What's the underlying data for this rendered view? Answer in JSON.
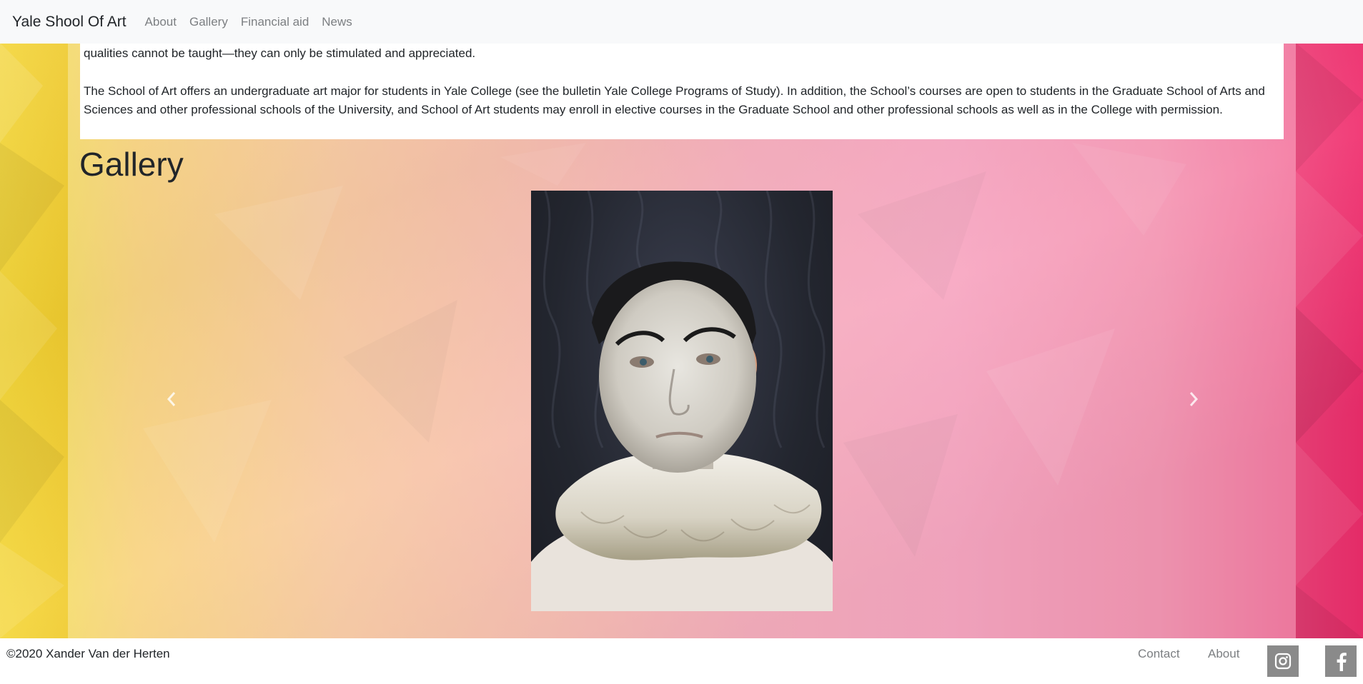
{
  "navbar": {
    "brand": "Yale Shool Of Art",
    "links": [
      "About",
      "Gallery",
      "Financial aid",
      "News"
    ]
  },
  "intro": {
    "paragraph1_partial": "qualities cannot be taught—they can only be stimulated and appreciated.",
    "paragraph2": "The School of Art offers an undergraduate art major for students in Yale College (see the bulletin Yale College Programs of Study). In addition, the School’s courses are open to students in the Graduate School of Arts and Sciences and other professional schools of the University, and School of Art students may enroll in elective courses in the Graduate School and other professional schools as well as in the College with permission."
  },
  "gallery": {
    "title": "Gallery",
    "prev_icon": "chevron-left-icon",
    "next_icon": "chevron-right-icon"
  },
  "footer": {
    "copyright": "©2020 Xander Van der Herten",
    "links": [
      "Contact",
      "About"
    ],
    "social": [
      "instagram-icon",
      "facebook-icon"
    ]
  },
  "colors": {
    "navbar_bg": "#f8f9fa",
    "bg_left": "#f5d73a",
    "bg_right": "#f02d6d",
    "social_bg": "#8a8a8a"
  }
}
